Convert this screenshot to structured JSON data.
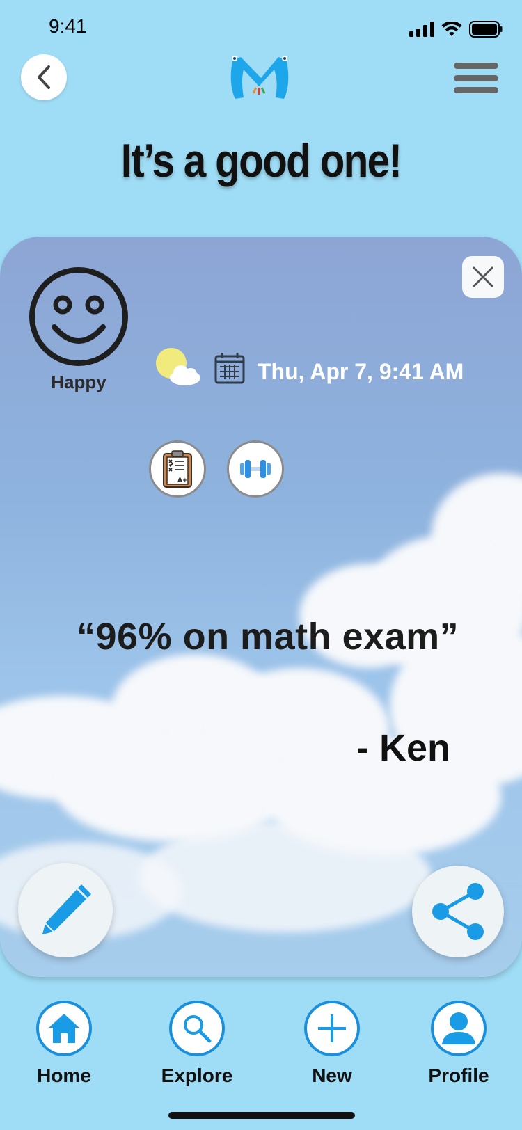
{
  "status_bar": {
    "time": "9:41"
  },
  "header": {
    "title": "It’s a good one!"
  },
  "entry": {
    "mood": "Happy",
    "datetime": "Thu, Apr 7, 9:41 AM",
    "quote": "“96% on math exam”",
    "author": "- Ken"
  },
  "nav": {
    "home": "Home",
    "explore": "Explore",
    "new": "New",
    "profile": "Profile"
  },
  "icons": {
    "back": "chevron-left-icon",
    "menu": "hamburger-menu-icon",
    "close": "close-icon",
    "weather": "partly-sunny-icon",
    "calendar": "calendar-icon",
    "tag1": "clipboard-grade-icon",
    "tag2": "dumbbell-icon",
    "edit": "pencil-icon",
    "share": "share-icon"
  },
  "colors": {
    "background": "#9fdcf5",
    "accent": "#1a9be6",
    "logo": "#1ea6ea"
  }
}
